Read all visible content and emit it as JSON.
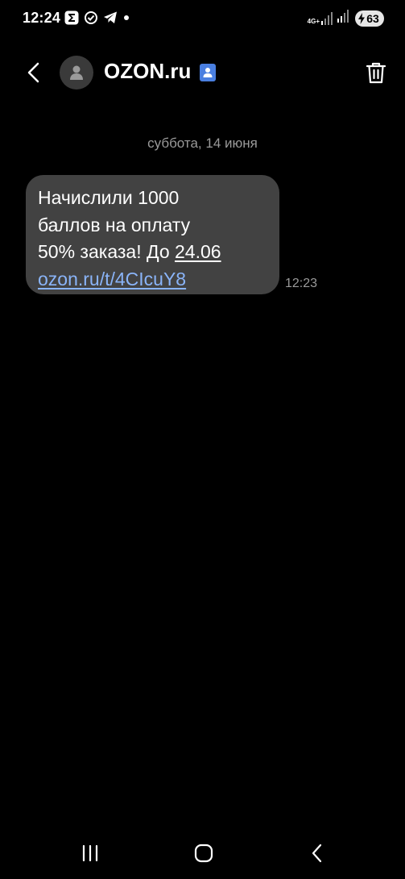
{
  "status_bar": {
    "time": "12:24",
    "network_type": "4G+",
    "battery_level": "63",
    "icons": [
      "sigma-icon",
      "check-circle-icon",
      "telegram-icon",
      "dot-icon",
      "signal-icon",
      "wifi-signal-icon",
      "battery-icon"
    ]
  },
  "header": {
    "contact_name": "OZON.ru",
    "icons": [
      "back-arrow-icon",
      "person-icon",
      "verified-contact-icon",
      "trash-icon"
    ],
    "accent_color": "#4a7fe0"
  },
  "conversation": {
    "date_separator": "суббота, 14 июня",
    "messages": [
      {
        "line1": "Начислили 1000",
        "line2": "баллов на оплату",
        "line3_text": "50% заказа! До ",
        "line3_date": "24.06",
        "link": "ozon.ru/t/4CIcuY8",
        "time": "12:23"
      }
    ],
    "bubble_color": "#424242",
    "link_color": "#8ab4f8"
  },
  "nav_bar": {
    "icons": [
      "recent-apps-icon",
      "home-icon",
      "back-icon"
    ]
  }
}
